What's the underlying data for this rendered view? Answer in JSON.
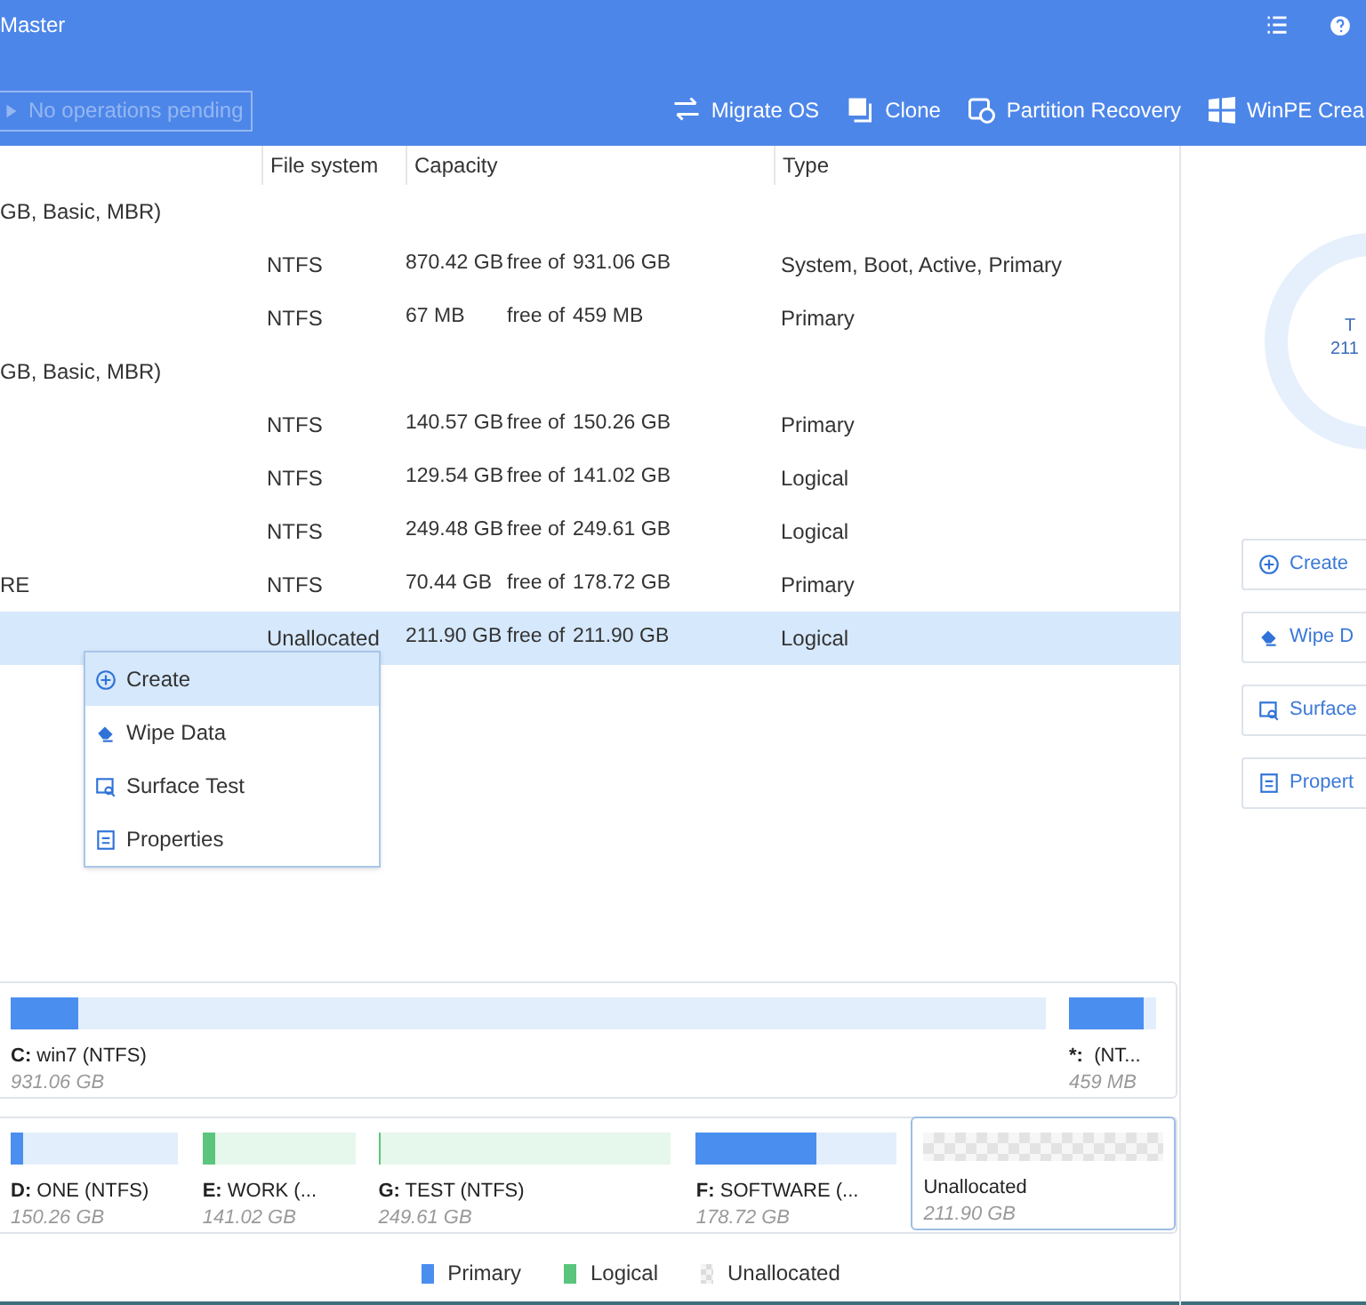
{
  "window": {
    "title": "Master"
  },
  "toolbar": {
    "pending": {
      "label": "No operations pending",
      "disabled": true
    },
    "actions": [
      {
        "label": "Migrate OS"
      },
      {
        "label": "Clone"
      },
      {
        "label": "Partition Recovery"
      },
      {
        "label": "WinPE Crea"
      }
    ]
  },
  "table": {
    "columns": [
      "File system",
      "Capacity",
      "Type"
    ],
    "rows": [
      {
        "kind": "disk",
        "label": "GB, Basic, MBR)"
      },
      {
        "kind": "partition",
        "name": "",
        "file_system": "NTFS",
        "free": "870.42 GB",
        "free_of": "free of",
        "total": "931.06 GB",
        "type": "System, Boot, Active, Primary",
        "selected": false
      },
      {
        "kind": "partition",
        "name": "",
        "file_system": "NTFS",
        "free": "67 MB",
        "free_of": "free of",
        "total": "459 MB",
        "type": "Primary",
        "selected": false
      },
      {
        "kind": "disk",
        "label": "GB, Basic, MBR)"
      },
      {
        "kind": "partition",
        "name": "",
        "file_system": "NTFS",
        "free": "140.57 GB",
        "free_of": "free of",
        "total": "150.26 GB",
        "type": "Primary",
        "selected": false
      },
      {
        "kind": "partition",
        "name": "",
        "file_system": "NTFS",
        "free": "129.54 GB",
        "free_of": "free of",
        "total": "141.02 GB",
        "type": "Logical",
        "selected": false
      },
      {
        "kind": "partition",
        "name": "",
        "file_system": "NTFS",
        "free": "249.48 GB",
        "free_of": "free of",
        "total": "249.61 GB",
        "type": "Logical",
        "selected": false
      },
      {
        "kind": "partition",
        "name": "RE",
        "file_system": "NTFS",
        "free": "70.44 GB",
        "free_of": "free of",
        "total": "178.72 GB",
        "type": "Primary",
        "selected": false
      },
      {
        "kind": "partition",
        "name": "",
        "file_system": "Unallocated",
        "free": "211.90 GB",
        "free_of": "free of",
        "total": "211.90 GB",
        "type": "Logical",
        "selected": true
      }
    ]
  },
  "context_menu": [
    {
      "label": "Create",
      "selected": true
    },
    {
      "label": "Wipe Data",
      "selected": false
    },
    {
      "label": "Surface Test",
      "selected": false
    },
    {
      "label": "Properties",
      "selected": false
    }
  ],
  "side_panel": {
    "donut_text": [
      "T",
      "211"
    ],
    "actions": [
      {
        "label": "Create"
      },
      {
        "label": "Wipe D"
      },
      {
        "label": "Surface"
      },
      {
        "label": "Propert"
      }
    ]
  },
  "disk_map": [
    {
      "partitions": [
        {
          "drive": "C:",
          "name": " win7 (NTFS)",
          "size": "931.06 GB",
          "kind": "primary",
          "level": 0.065,
          "selected": false
        },
        {
          "drive": "*:",
          "name": "  (NT...",
          "size": "459 MB",
          "kind": "primary",
          "level": 0.85,
          "selected": false
        }
      ]
    },
    {
      "partitions": [
        {
          "drive": "D:",
          "name": " ONE (NTFS)",
          "size": "150.26 GB",
          "kind": "primary",
          "level": 0.07,
          "selected": false
        },
        {
          "drive": "E:",
          "name": " WORK (...",
          "size": "141.02 GB",
          "kind": "logical",
          "level": 0.08,
          "selected": false
        },
        {
          "drive": "G:",
          "name": " TEST (NTFS)",
          "size": "249.61 GB",
          "kind": "logical",
          "level": 0.01,
          "selected": false
        },
        {
          "drive": "F:",
          "name": " SOFTWARE (...",
          "size": "178.72 GB",
          "kind": "primary",
          "level": 0.6,
          "selected": false
        },
        {
          "name": "Unallocated",
          "size": "211.90 GB",
          "kind": "unallocated",
          "selected": true
        }
      ]
    }
  ],
  "legend": [
    {
      "label": "Primary",
      "kind": "primary"
    },
    {
      "label": "Logical",
      "kind": "logical"
    },
    {
      "label": "Unallocated",
      "kind": "unallocated"
    }
  ]
}
